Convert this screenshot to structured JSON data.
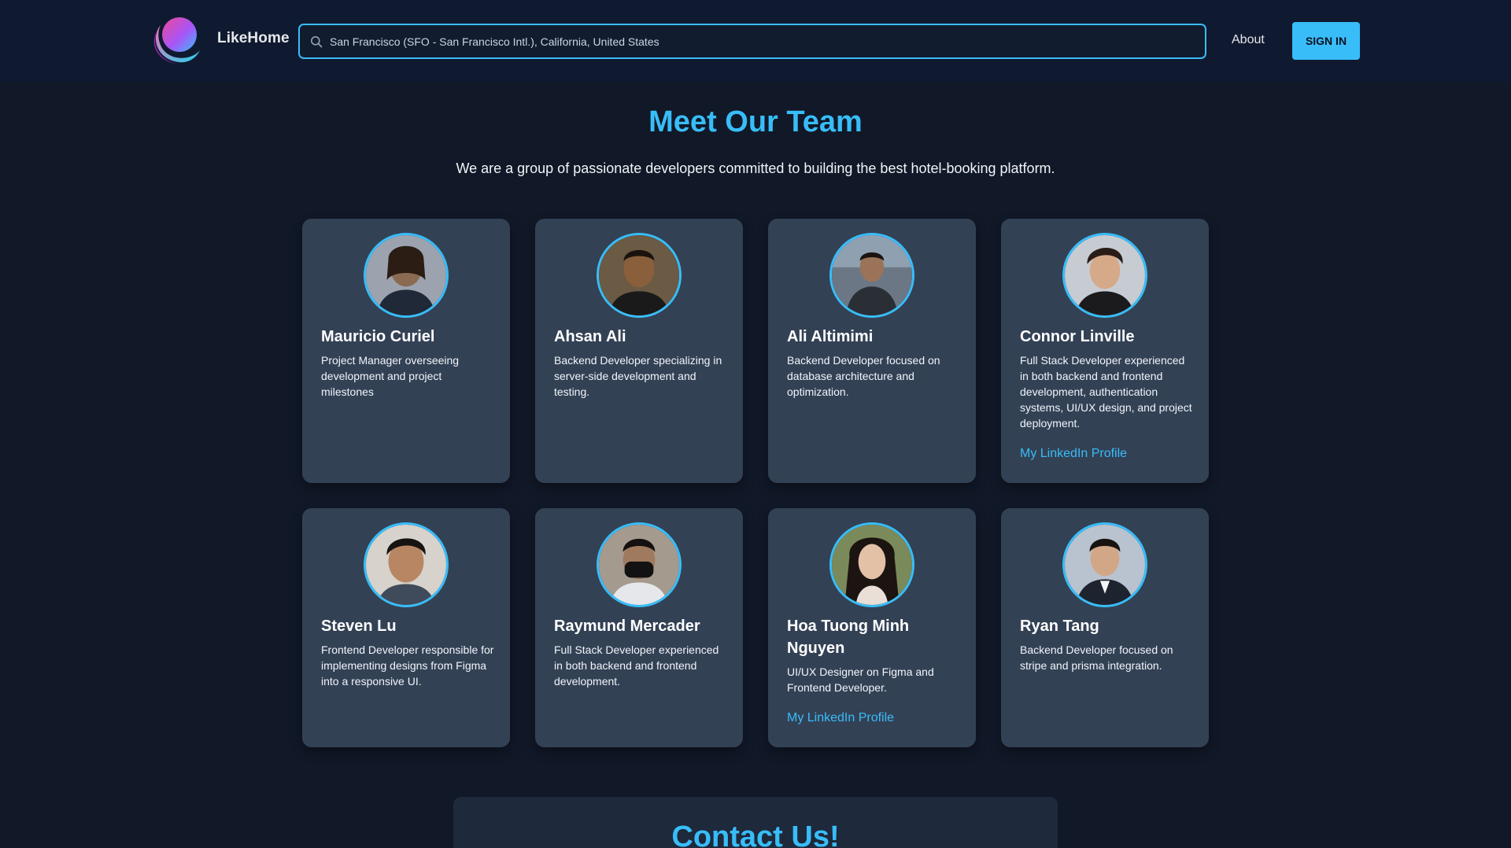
{
  "header": {
    "brand": "LikeHome",
    "search_value": "San Francisco (SFO - San Francisco Intl.), California, United States",
    "about_label": "About",
    "signin_label": "SIGN IN"
  },
  "team": {
    "title": "Meet Our Team",
    "subtitle": "We are a group of passionate developers committed to building the best hotel-booking platform.",
    "members": [
      {
        "name": "Mauricio Curiel",
        "desc": "Project Manager overseeing development and project milestones",
        "link": ""
      },
      {
        "name": "Ahsan Ali",
        "desc": "Backend Developer specializing in server-side development and testing.",
        "link": ""
      },
      {
        "name": "Ali Altimimi",
        "desc": "Backend Developer focused on database architecture and optimization.",
        "link": ""
      },
      {
        "name": "Connor Linville",
        "desc": "Full Stack Developer experienced in both backend and frontend development, authentication systems, UI/UX design, and project deployment.",
        "link": "My LinkedIn Profile"
      },
      {
        "name": "Steven Lu",
        "desc": "Frontend Developer responsible for implementing designs from Figma into a responsive UI.",
        "link": ""
      },
      {
        "name": "Raymund Mercader",
        "desc": "Full Stack Developer experienced in both backend and frontend development.",
        "link": ""
      },
      {
        "name": "Hoa Tuong Minh Nguyen",
        "desc": "UI/UX Designer on Figma and Frontend Developer.",
        "link": "My LinkedIn Profile"
      },
      {
        "name": "Ryan Tang",
        "desc": "Backend Developer focused on stripe and prisma integration.",
        "link": ""
      }
    ]
  },
  "contact": {
    "title": "Contact Us!"
  },
  "colors": {
    "accent": "#38bdf8",
    "background": "#111827",
    "card": "#334155",
    "header": "#0f1a30"
  },
  "icons": [
    "likehome-logo",
    "search-icon",
    "avatar-photo"
  ]
}
